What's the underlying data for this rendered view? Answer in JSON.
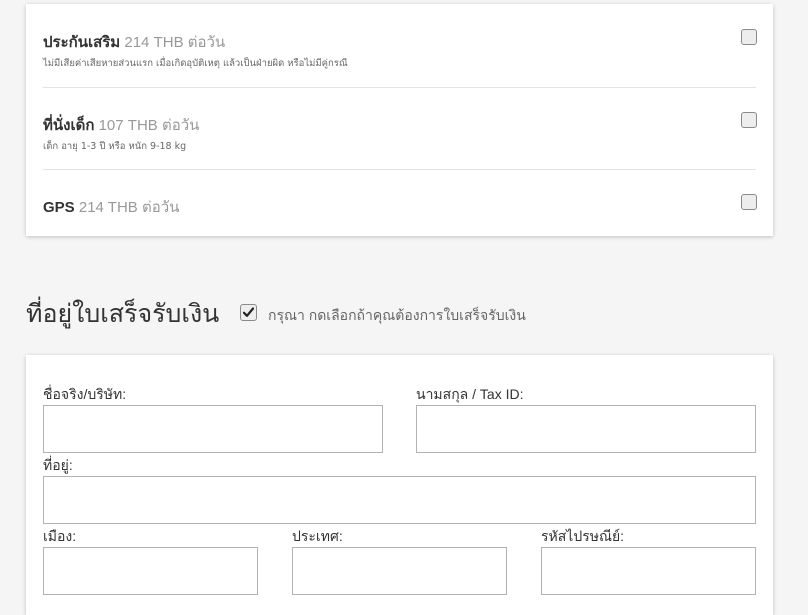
{
  "extras": [
    {
      "name": "ประกันเสริม",
      "price": "214 THB ต่อวัน",
      "desc": "ไม่มีเสียค่าเสียหายส่วนแรก เมื่อเกิดอุบัติเหตุ แล้วเป็นฝ่ายผิด หรือไม่มีคู่กรณี",
      "checked": false
    },
    {
      "name": "ที่นั่งเด็ก",
      "price": "107 THB ต่อวัน",
      "desc": "เด็ก อายุ 1-3 ปี หรือ หนัก 9-18 kg",
      "checked": false
    },
    {
      "name": "GPS",
      "price": "214 THB ต่อวัน",
      "checked": false
    }
  ],
  "receipt": {
    "title": "ที่อยู่ใบเสร็จรับเงิน",
    "checked": true,
    "note": "กรุณา กดเลือกถ้าคุณต้องการใบเสร็จรับเงิน"
  },
  "form": {
    "name_label": "ชื่อจริง/บริษัท:",
    "surname_label": "นามสกุล / Tax ID:",
    "address_label": "ที่อยู่:",
    "city_label": "เมือง:",
    "country_label": "ประเทศ:",
    "postcode_label": "รหัสไปรษณีย์:",
    "name_value": "",
    "surname_value": "",
    "address_value": "",
    "city_value": "",
    "country_value": "",
    "postcode_value": ""
  }
}
